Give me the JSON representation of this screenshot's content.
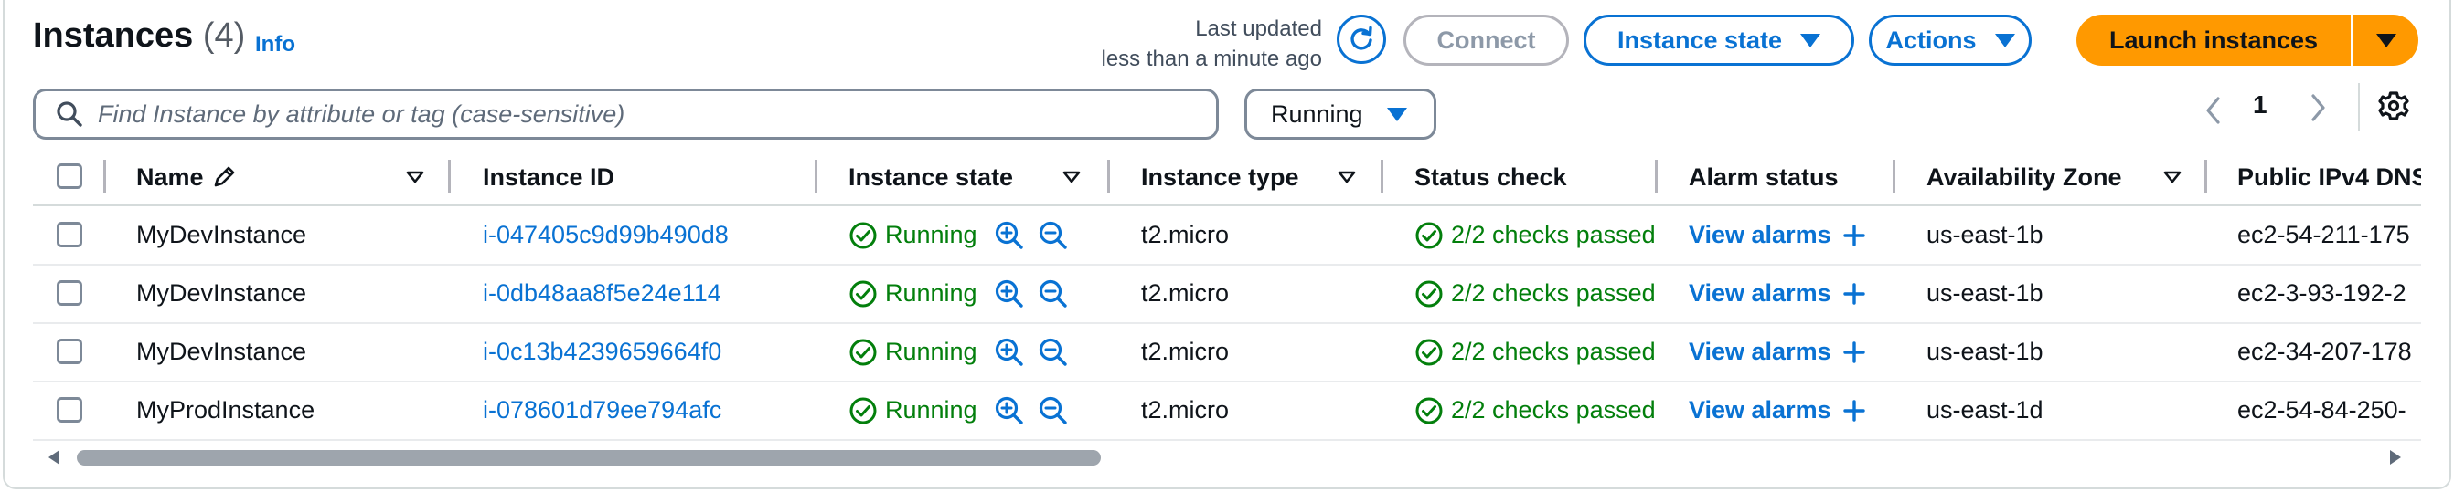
{
  "header": {
    "title": "Instances",
    "count": "(4)",
    "info": "Info",
    "last_updated_line1": "Last updated",
    "last_updated_line2": "less than a minute ago",
    "connect": "Connect",
    "instance_state": "Instance state",
    "actions": "Actions",
    "launch": "Launch instances"
  },
  "toolbar": {
    "search_placeholder": "Find Instance by attribute or tag (case-sensitive)",
    "filter_value": "Running",
    "page": "1"
  },
  "columns": {
    "name": "Name",
    "instance_id": "Instance ID",
    "instance_state": "Instance state",
    "instance_type": "Instance type",
    "status_check": "Status check",
    "alarm_status": "Alarm status",
    "availability_zone": "Availability Zone",
    "public_ipv4_dns": "Public IPv4 DNS"
  },
  "rows": [
    {
      "name": "MyDevInstance",
      "id": "i-047405c9d99b490d8",
      "state": "Running",
      "type": "t2.micro",
      "status": "2/2 checks passed",
      "alarm": "View alarms",
      "az": "us-east-1b",
      "dns": "ec2-54-211-175"
    },
    {
      "name": "MyDevInstance",
      "id": "i-0db48aa8f5e24e114",
      "state": "Running",
      "type": "t2.micro",
      "status": "2/2 checks passed",
      "alarm": "View alarms",
      "az": "us-east-1b",
      "dns": "ec2-3-93-192-2"
    },
    {
      "name": "MyDevInstance",
      "id": "i-0c13b4239659664f0",
      "state": "Running",
      "type": "t2.micro",
      "status": "2/2 checks passed",
      "alarm": "View alarms",
      "az": "us-east-1b",
      "dns": "ec2-34-207-178"
    },
    {
      "name": "MyProdInstance",
      "id": "i-078601d79ee794afc",
      "state": "Running",
      "type": "t2.micro",
      "status": "2/2 checks passed",
      "alarm": "View alarms",
      "az": "us-east-1d",
      "dns": "ec2-54-84-250-"
    }
  ],
  "colors": {
    "link": "#0972d3",
    "success": "#037f0c",
    "primary_button": "#ff9900",
    "border": "#7d8998"
  },
  "icons": {
    "refresh": "refresh-icon",
    "search": "search-icon",
    "settings": "gear-icon",
    "edit": "pencil-icon",
    "status": "check-circle-icon",
    "zoom_in": "zoom-in-icon",
    "zoom_out": "zoom-out-icon",
    "add": "plus-icon"
  }
}
